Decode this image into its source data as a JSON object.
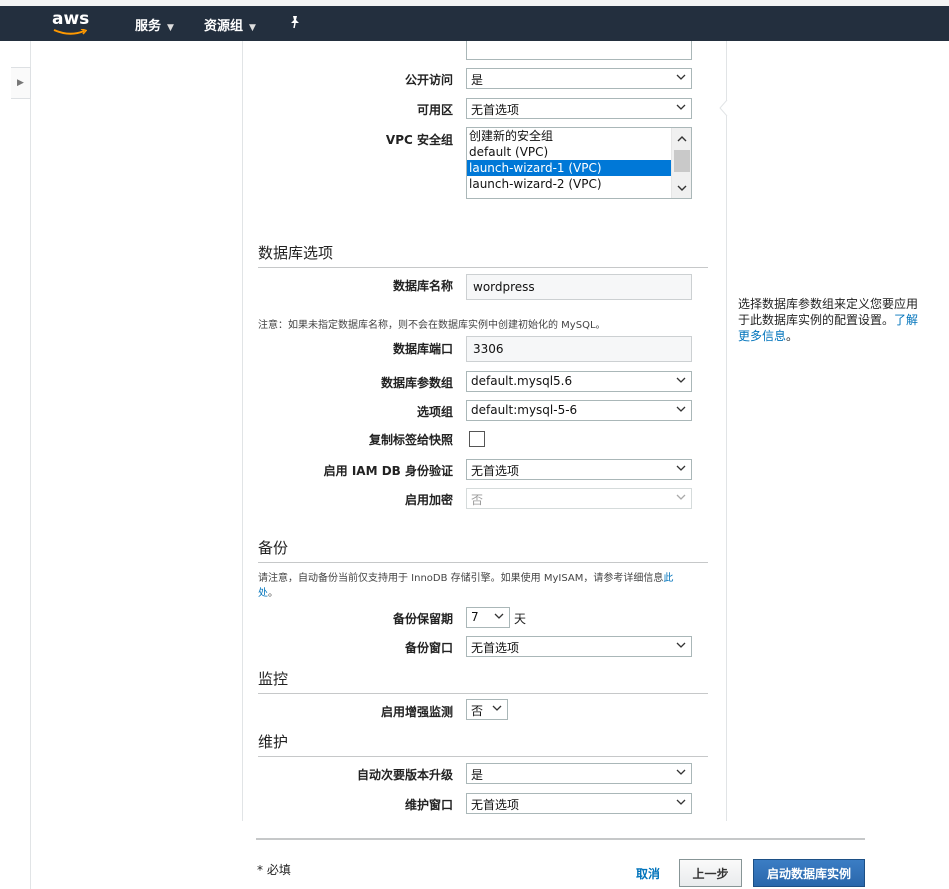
{
  "nav": {
    "logo": "aws",
    "services": "服务",
    "resource_groups": "资源组"
  },
  "network": {
    "public_access": {
      "label": "公开访问",
      "value": "是"
    },
    "availability_zone": {
      "label": "可用区",
      "value": "无首选项"
    },
    "vpc_sg": {
      "label": "VPC 安全组",
      "options": [
        "创建新的安全组",
        "default (VPC)",
        "launch-wizard-1 (VPC)",
        "launch-wizard-2 (VPC)"
      ],
      "selected_index": 2
    }
  },
  "db_options": {
    "title": "数据库选项",
    "db_name": {
      "label": "数据库名称",
      "value": "wordpress"
    },
    "note": "注意：如果未指定数据库名称，则不会在数据库实例中创建初始化的 MySQL。",
    "db_port": {
      "label": "数据库端口",
      "value": "3306"
    },
    "param_group": {
      "label": "数据库参数组",
      "value": "default.mysql5.6"
    },
    "option_group": {
      "label": "选项组",
      "value": "default:mysql-5-6"
    },
    "copy_tags": {
      "label": "复制标签给快照",
      "checked": false
    },
    "iam_auth": {
      "label": "启用 IAM DB 身份验证",
      "value": "无首选项"
    },
    "encryption": {
      "label": "启用加密",
      "value": "否"
    }
  },
  "backup": {
    "title": "备份",
    "note": "请注意，自动备份当前仅支持用于 InnoDB 存储引擎。如果使用 MyISAM，请参考详细信息",
    "note_link_1": "此",
    "note_link_2": "处",
    "note_end": "。",
    "retention": {
      "label": "备份保留期",
      "value": "7",
      "unit": "天"
    },
    "window": {
      "label": "备份窗口",
      "value": "无首选项"
    }
  },
  "monitoring": {
    "title": "监控",
    "enhanced": {
      "label": "启用增强监测",
      "value": "否"
    }
  },
  "maintenance": {
    "title": "维护",
    "auto_minor": {
      "label": "自动次要版本升级",
      "value": "是"
    },
    "window": {
      "label": "维护窗口",
      "value": "无首选项"
    }
  },
  "help": {
    "text": "选择数据库参数组来定义您要应用于此数据库实例的配置设置。",
    "link": "了解更多信息",
    "suffix": "。"
  },
  "footer": {
    "required": "* 必填",
    "cancel": "取消",
    "previous": "上一步",
    "launch": "启动数据库实例"
  },
  "colors": {
    "navbar": "#232f3e",
    "link": "#0073bb",
    "primary_button": "#2a67ab",
    "list_selection": "#0078d7"
  }
}
